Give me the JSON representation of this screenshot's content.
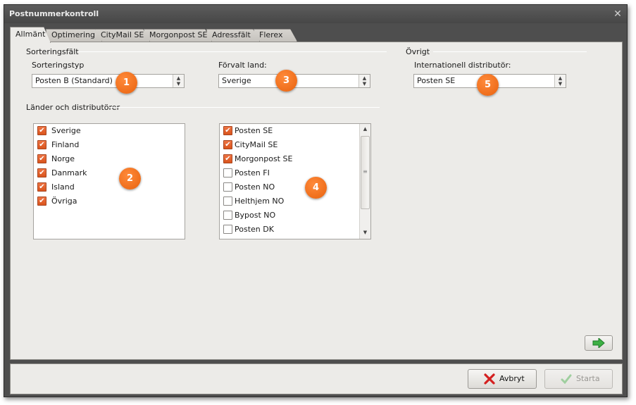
{
  "window": {
    "title": "Postnummerkontroll"
  },
  "tabs": [
    "Allmänt",
    "Optimering",
    "CityMail SE",
    "Morgonpost SE",
    "Adressfält",
    "Flerex"
  ],
  "sorting": {
    "group_title": "Sorteringsfält",
    "type_label": "Sorteringstyp",
    "type_value": "Posten B (Standard)",
    "country_label": "Förvalt land:",
    "country_value": "Sverige"
  },
  "other": {
    "group_title": "Övrigt",
    "distributor_label": "Internationell distributör:",
    "distributor_value": "Posten SE"
  },
  "countries": {
    "group_title": "Länder och distributörer",
    "items": [
      {
        "label": "Sverige",
        "checked": true
      },
      {
        "label": "Finland",
        "checked": true
      },
      {
        "label": "Norge",
        "checked": true
      },
      {
        "label": "Danmark",
        "checked": true
      },
      {
        "label": "Island",
        "checked": true
      },
      {
        "label": "Övriga",
        "checked": true
      }
    ]
  },
  "distributors": {
    "items": [
      {
        "label": "Posten SE",
        "checked": true
      },
      {
        "label": "CityMail SE",
        "checked": true
      },
      {
        "label": "Morgonpost SE",
        "checked": true
      },
      {
        "label": "Posten FI",
        "checked": false
      },
      {
        "label": "Posten NO",
        "checked": false
      },
      {
        "label": "Helthjem NO",
        "checked": false
      },
      {
        "label": "Bypost NO",
        "checked": false
      },
      {
        "label": "Posten DK",
        "checked": false
      }
    ]
  },
  "badges": [
    "1",
    "2",
    "3",
    "4",
    "5"
  ],
  "buttons": {
    "cancel_label": "Avbryt",
    "start_label": "Starta"
  },
  "colors": {
    "accent": "#ee7444",
    "badge": "#f07020",
    "next_arrow": "#3cb043",
    "cancel_icon": "#d42020"
  }
}
